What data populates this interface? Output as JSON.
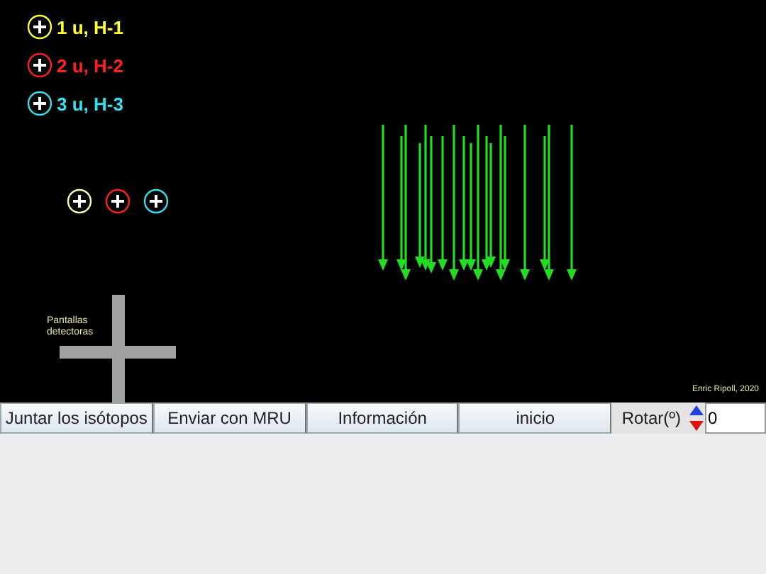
{
  "isotopes": [
    {
      "label": "1 u, H-1",
      "color": "#ffff33"
    },
    {
      "label": "2 u, H-2",
      "color": "#ff2020"
    },
    {
      "label": "3 u, H-3",
      "color": "#33e0f0"
    }
  ],
  "launch_markers": [
    {
      "color": "#ffffb0"
    },
    {
      "color": "#ff2020"
    },
    {
      "color": "#33e0f0"
    }
  ],
  "detector_label": "Pantallas\ndetectoras",
  "credit": "Enric Ripoll, 2020",
  "buttons": [
    "Juntar los isótopos",
    "Enviar con MRU",
    "Información",
    "inicio"
  ],
  "rotation": {
    "label": "Rotar(º)",
    "value": "0"
  }
}
